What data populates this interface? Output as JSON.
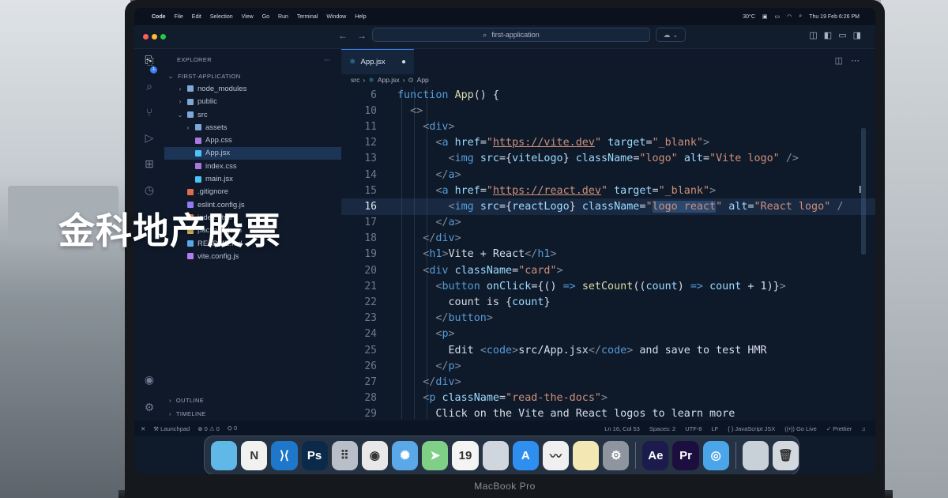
{
  "overlay": {
    "title": "金科地产股票"
  },
  "laptop": {
    "label": "MacBook Pro"
  },
  "menubar": {
    "items": [
      "Code",
      "File",
      "Edit",
      "Selection",
      "View",
      "Go",
      "Run",
      "Terminal",
      "Window",
      "Help"
    ],
    "weather": "30°C",
    "datetime": "Thu 19 Feb  6:26 PM"
  },
  "titlebar": {
    "search_text": "first-application"
  },
  "explorer": {
    "header": "EXPLORER",
    "project": "FIRST-APPLICATION",
    "items": [
      {
        "label": "node_modules",
        "kind": "folder",
        "depth": 1,
        "open": false
      },
      {
        "label": "public",
        "kind": "folder",
        "depth": 1,
        "open": false
      },
      {
        "label": "src",
        "kind": "folder",
        "depth": 1,
        "open": true
      },
      {
        "label": "assets",
        "kind": "folder",
        "depth": 2,
        "open": false
      },
      {
        "label": "App.css",
        "kind": "css",
        "depth": 2
      },
      {
        "label": "App.jsx",
        "kind": "jsx",
        "depth": 2,
        "selected": true
      },
      {
        "label": "index.css",
        "kind": "css",
        "depth": 2
      },
      {
        "label": "main.jsx",
        "kind": "jsx",
        "depth": 2
      },
      {
        "label": ".gitignore",
        "kind": "git",
        "depth": 1
      },
      {
        "label": "eslint.config.js",
        "kind": "eslint",
        "depth": 1
      },
      {
        "label": "index.html",
        "kind": "html",
        "depth": 1
      },
      {
        "label": "package.json",
        "kind": "json",
        "depth": 1
      },
      {
        "label": "README.md",
        "kind": "md",
        "depth": 1
      },
      {
        "label": "vite.config.js",
        "kind": "vite",
        "depth": 1
      }
    ],
    "outline": "OUTLINE",
    "timeline": "TIMELINE"
  },
  "editor": {
    "tab": "App.jsx",
    "breadcrumb": [
      "src",
      "App.jsx",
      "App"
    ],
    "current_line": 16,
    "lines": [
      {
        "n": "6",
        "html": "<span class='k'>function</span> <span class='f'>App</span>() {"
      },
      {
        "n": "10",
        "html": "  <span class='p'>&lt;&gt;</span>"
      },
      {
        "n": "11",
        "html": "    <span class='p'>&lt;</span><span class='k'>div</span><span class='p'>&gt;</span>"
      },
      {
        "n": "12",
        "html": "      <span class='p'>&lt;</span><span class='k'>a</span> <span class='a'>href</span>=<span class='s'>\"<u>https://vite.dev</u>\"</span> <span class='a'>target</span>=<span class='s'>\"_blank\"</span><span class='p'>&gt;</span>"
      },
      {
        "n": "13",
        "html": "        <span class='p'>&lt;</span><span class='k'>img</span> <span class='a'>src</span>={<span class='a'>viteLogo</span>} <span class='a'>className</span>=<span class='s'>\"logo\"</span> <span class='a'>alt</span>=<span class='s'>\"Vite logo\"</span> <span class='p'>/&gt;</span>"
      },
      {
        "n": "14",
        "html": "      <span class='p'>&lt;/</span><span class='k'>a</span><span class='p'>&gt;</span>"
      },
      {
        "n": "15",
        "html": "      <span class='p'>&lt;</span><span class='k'>a</span> <span class='a'>href</span>=<span class='s'>\"<u>https://react.dev</u>\"</span> <span class='a'>target</span>=<span class='s'>\"_blank\"</span><span class='p'>&gt;</span>"
      },
      {
        "n": "16",
        "html": "        <span class='p'>&lt;</span><span class='k'>img</span> <span class='a'>src</span>={<span class='a'>reactLogo</span>} <span class='a'>className</span>=<span class='s'>\"<span class='sel'>logo react</span>\"</span> <span class='a'>alt</span>=<span class='s'>\"React logo\"</span> <span class='p'>/</span>"
      },
      {
        "n": "17",
        "html": "      <span class='p'>&lt;/</span><span class='k'>a</span><span class='p'>&gt;</span>"
      },
      {
        "n": "18",
        "html": "    <span class='p'>&lt;/</span><span class='k'>div</span><span class='p'>&gt;</span>"
      },
      {
        "n": "19",
        "html": "    <span class='p'>&lt;</span><span class='k'>h1</span><span class='p'>&gt;</span>Vite + React<span class='p'>&lt;/</span><span class='k'>h1</span><span class='p'>&gt;</span>"
      },
      {
        "n": "20",
        "html": "    <span class='p'>&lt;</span><span class='k'>div</span> <span class='a'>className</span>=<span class='s'>\"card\"</span><span class='p'>&gt;</span>"
      },
      {
        "n": "21",
        "html": "      <span class='p'>&lt;</span><span class='k'>button</span> <span class='a'>onClick</span>={() <span class='k'>=&gt;</span> <span class='f'>setCount</span>((<span class='a'>count</span>) <span class='k'>=&gt;</span> <span class='a'>count</span> + 1)}<span class='p'>&gt;</span>"
      },
      {
        "n": "22",
        "html": "        count is {<span class='a'>count</span>}"
      },
      {
        "n": "23",
        "html": "      <span class='p'>&lt;/</span><span class='k'>button</span><span class='p'>&gt;</span>"
      },
      {
        "n": "24",
        "html": "      <span class='p'>&lt;</span><span class='k'>p</span><span class='p'>&gt;</span>"
      },
      {
        "n": "25",
        "html": "        Edit <span class='p'>&lt;</span><span class='k'>code</span><span class='p'>&gt;</span>src/App.jsx<span class='p'>&lt;/</span><span class='k'>code</span><span class='p'>&gt;</span> and save to test HMR"
      },
      {
        "n": "26",
        "html": "      <span class='p'>&lt;/</span><span class='k'>p</span><span class='p'>&gt;</span>"
      },
      {
        "n": "27",
        "html": "    <span class='p'>&lt;/</span><span class='k'>div</span><span class='p'>&gt;</span>"
      },
      {
        "n": "28",
        "html": "    <span class='p'>&lt;</span><span class='k'>p</span> <span class='a'>className</span>=<span class='s'>\"read-the-docs\"</span><span class='p'>&gt;</span>"
      },
      {
        "n": "29",
        "html": "      Click on the Vite and React logos to learn more"
      }
    ]
  },
  "statusbar": {
    "branch": "Launchpad",
    "problems": "⊗ 0  ⚠ 0",
    "ports": "0",
    "position": "Ln 16, Col 53",
    "spaces": "Spaces: 2",
    "encoding": "UTF-8",
    "eol": "LF",
    "language": "{ } JavaScript JSX",
    "golive": "Go Live",
    "prettier": "✓ Prettier"
  },
  "dock": {
    "apps": [
      {
        "name": "finder",
        "label": "",
        "color": "#5fb8e6"
      },
      {
        "name": "notion",
        "label": "N",
        "color": "#f1f1ef"
      },
      {
        "name": "vscode",
        "label": "⟩⟨",
        "color": "#1e77c8"
      },
      {
        "name": "photoshop",
        "label": "Ps",
        "color": "#0b2a4a"
      },
      {
        "name": "launchpad",
        "label": "⠿",
        "color": "#b9bfc8"
      },
      {
        "name": "chrome",
        "label": "◉",
        "color": "#e8e8e8"
      },
      {
        "name": "safari",
        "label": "✺",
        "color": "#5aa8e8"
      },
      {
        "name": "maps",
        "label": "➤",
        "color": "#7fcf86"
      },
      {
        "name": "calendar",
        "label": "19",
        "color": "#f4f4f4"
      },
      {
        "name": "finder-2",
        "label": "",
        "color": "#cfd6de"
      },
      {
        "name": "app-store",
        "label": "A",
        "color": "#2f8ff0"
      },
      {
        "name": "freeform",
        "label": "〰",
        "color": "#f0f0f0"
      },
      {
        "name": "notes",
        "label": "",
        "color": "#f3e7b3"
      },
      {
        "name": "settings",
        "label": "⚙",
        "color": "#8e959e"
      },
      {
        "name": "after-effects",
        "label": "Ae",
        "color": "#1b1b4d"
      },
      {
        "name": "premiere",
        "label": "Pr",
        "color": "#1c0f3f"
      },
      {
        "name": "proxyman",
        "label": "◎",
        "color": "#4aa6e8"
      },
      {
        "name": "downloads",
        "label": "",
        "color": "#c8d0d8"
      },
      {
        "name": "trash",
        "label": "🗑",
        "color": "#d3d8de"
      }
    ]
  },
  "colors": {
    "accent": "#3b82f6",
    "editor_bg": "#0e192a",
    "sidebar_bg": "#0f1929"
  }
}
